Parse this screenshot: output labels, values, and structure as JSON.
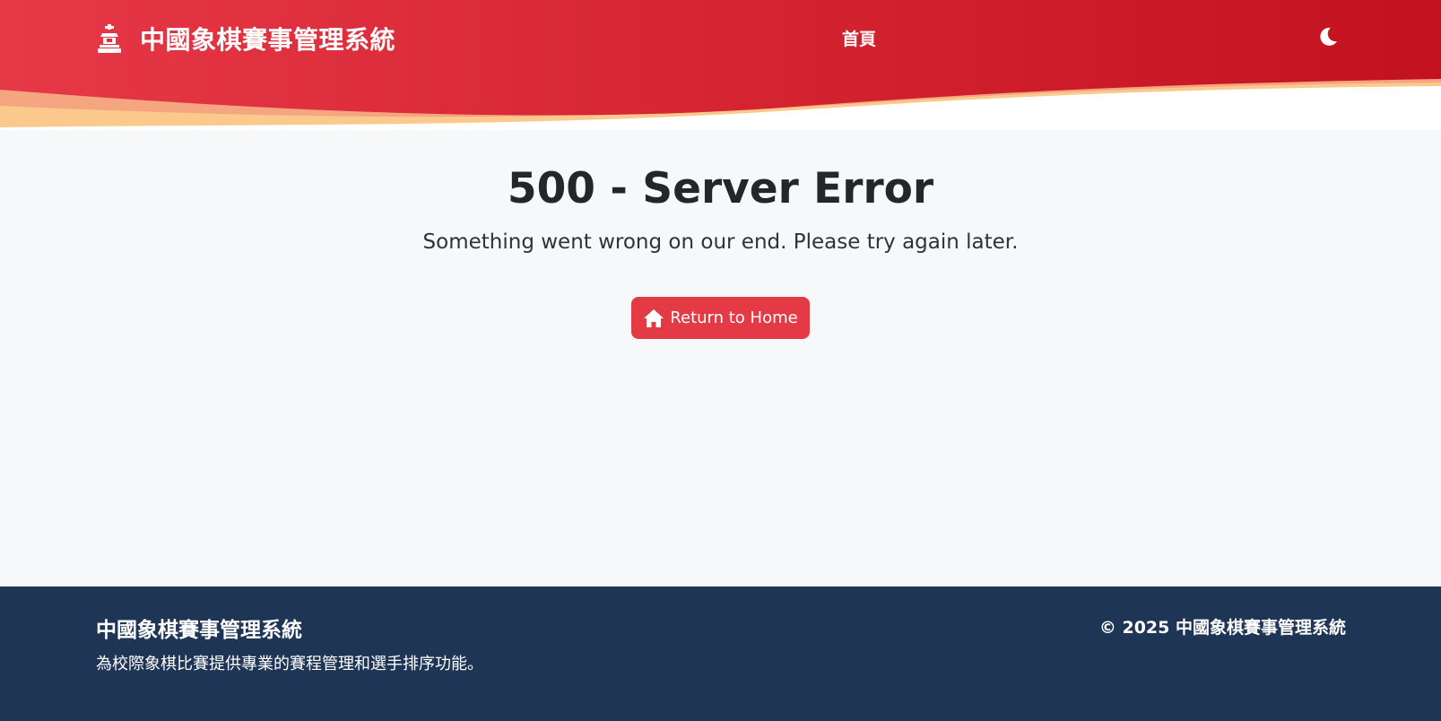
{
  "header": {
    "brand_text": "中國象棋賽事管理系統",
    "brand_icon": "chess-piece-icon",
    "nav_home": "首頁",
    "theme_icon": "moon-icon",
    "colors": {
      "gradient_start": "#e73847",
      "gradient_end": "#c3121f",
      "wave_light": "#fcc98c",
      "wave_mid": "#f3a07f"
    }
  },
  "main": {
    "title": "500 - Server Error",
    "subtitle": "Something went wrong on our end. Please try again later.",
    "home_button": "Return to Home",
    "home_button_icon": "home-icon",
    "accent": "#e33a46"
  },
  "footer": {
    "title": "中國象棋賽事管理系統",
    "description": "為校際象棋比賽提供專業的賽程管理和選手排序功能。",
    "copyright": "© 2025 中國象棋賽事管理系統",
    "background": "#1f3556"
  }
}
